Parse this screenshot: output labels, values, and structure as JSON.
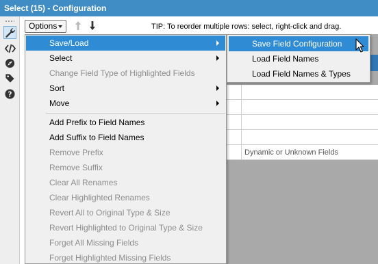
{
  "window": {
    "title": "Select (15) - Configuration"
  },
  "toolbar": {
    "options_label": "Options",
    "tip": "TIP: To reorder multiple rows: select, right-click and drag."
  },
  "sidebar_icons": [
    "wrench-icon",
    "code-icon",
    "compass-icon",
    "tag-icon",
    "help-icon"
  ],
  "menu": {
    "items": [
      {
        "label": "Save/Load"
      },
      {
        "label": "Select"
      },
      {
        "label": "Change Field Type of Highlighted Fields"
      },
      {
        "label": "Sort"
      },
      {
        "label": "Move"
      },
      {
        "label": "Add Prefix to Field Names"
      },
      {
        "label": "Add Suffix to Field Names"
      },
      {
        "label": "Remove Prefix"
      },
      {
        "label": "Remove Suffix"
      },
      {
        "label": "Clear All Renames"
      },
      {
        "label": "Clear Highlighted Renames"
      },
      {
        "label": "Revert All to Original Type & Size"
      },
      {
        "label": "Revert Highlighted to Original Type & Size"
      },
      {
        "label": "Forget All Missing Fields"
      },
      {
        "label": "Forget Highlighted Missing Fields"
      }
    ]
  },
  "submenu": {
    "items": [
      {
        "label": "Save Field Configuration"
      },
      {
        "label": "Load Field Names"
      },
      {
        "label": "Load Field Names & Types"
      }
    ]
  },
  "grid": {
    "dynamic_label": "Dynamic or Unknown Fields"
  },
  "colors": {
    "title_bar": "#3f8dc4",
    "highlight": "#2f8bd3",
    "disabled_text": "#8d8d8d"
  }
}
